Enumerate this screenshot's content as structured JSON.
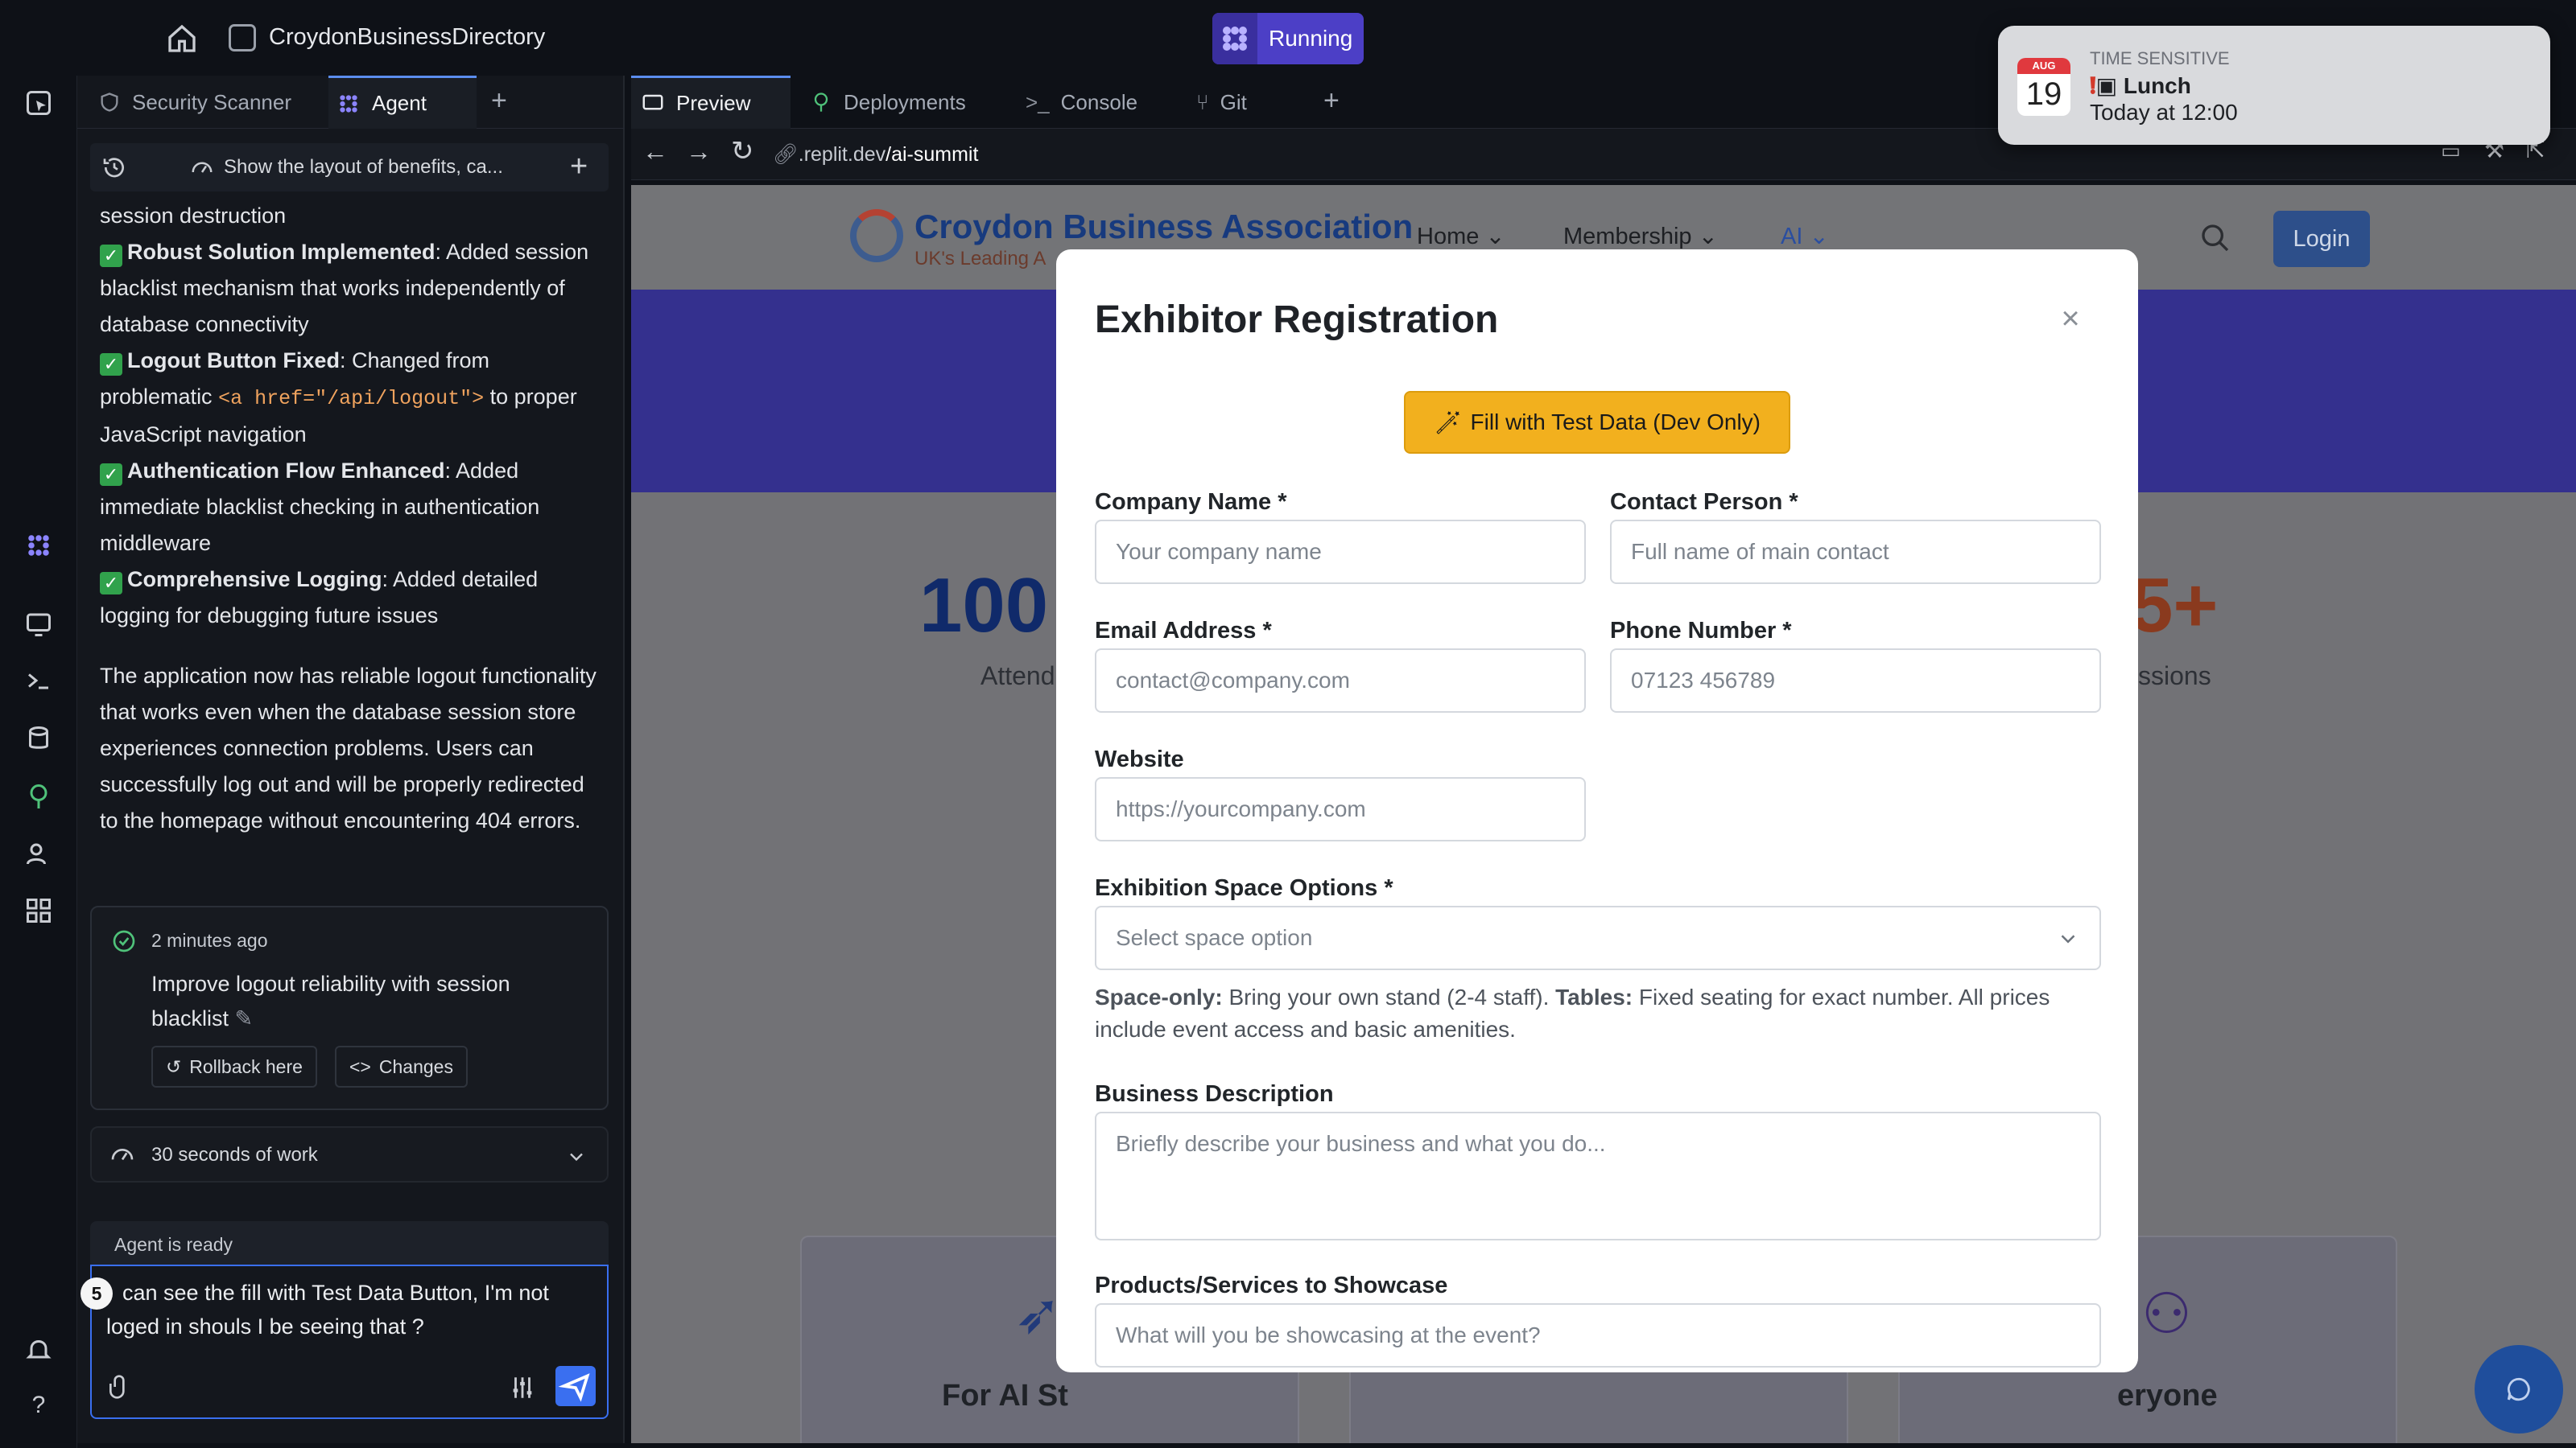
{
  "topbar": {
    "repl_name": "CroydonBusinessDirectory",
    "run_label": "Running"
  },
  "left_tabs": [
    {
      "label": "Security Scanner"
    },
    {
      "label": "Agent"
    }
  ],
  "history": {
    "title": "Show the layout of benefits, ca..."
  },
  "chat": {
    "line_top": "session destruction",
    "items": [
      {
        "bold": "Robust Solution Implemented",
        "text": ": Added session blacklist mechanism that works independently of database connectivity"
      },
      {
        "bold": "Logout Button Fixed",
        "text_a": ": Changed from problematic ",
        "code": "<a href=\"/api/logout\">",
        "text_b": " to proper JavaScript navigation"
      },
      {
        "bold": "Authentication Flow Enhanced",
        "text": ": Added immediate blacklist checking in authentication middleware"
      },
      {
        "bold": "Comprehensive Logging",
        "text": ": Added detailed logging for debugging future issues"
      }
    ],
    "summary": "The application now has reliable logout functionality that works even when the database session store experiences connection problems. Users can successfully log out and will be properly redirected to the homepage without encountering 404 errors."
  },
  "checkpoint": {
    "time": "2 minutes ago",
    "title": "Improve logout reliability with session blacklist",
    "rollback_label": "Rollback here",
    "changes_label": "Changes"
  },
  "work": {
    "label": "30 seconds of work"
  },
  "agent_status": "Agent is ready",
  "input": {
    "badge": "5",
    "text": "can see the fill with Test Data Button, I'm not loged in shouls I be seeing that ?"
  },
  "right_tabs": [
    {
      "label": "Preview"
    },
    {
      "label": "Deployments"
    },
    {
      "label": "Console"
    },
    {
      "label": "Git"
    }
  ],
  "url": {
    "host": ".replit.dev",
    "path": "/ai-summit"
  },
  "site": {
    "brand": "Croydon Business Association",
    "tagline": "UK's Leading A",
    "nav": [
      "Home",
      "Membership",
      "AI"
    ],
    "login": "Login",
    "stat_left_num": "100",
    "stat_left_label": "Attend",
    "stat_right_num": "5+",
    "stat_right_label": "ssions",
    "card_left": "For AI St",
    "card_right": "eryone"
  },
  "modal": {
    "title": "Exhibitor Registration",
    "fill_button": "Fill with Test Data (Dev Only)",
    "company_label": "Company Name *",
    "company_ph": "Your company name",
    "contact_label": "Contact Person *",
    "contact_ph": "Full name of main contact",
    "email_label": "Email Address *",
    "email_ph": "contact@company.com",
    "phone_label": "Phone Number *",
    "phone_ph": "07123 456789",
    "website_label": "Website",
    "website_ph": "https://yourcompany.com",
    "space_label": "Exhibition Space Options *",
    "space_ph": "Select space option",
    "help_b1": "Space-only:",
    "help_t1": " Bring your own stand (2-4 staff). ",
    "help_b2": "Tables:",
    "help_t2": " Fixed seating for exact number. All prices include event access and basic amenities.",
    "desc_label": "Business Description",
    "desc_ph": "Briefly describe your business and what you do...",
    "products_label": "Products/Services to Showcase",
    "products_ph": "What will you be showcasing at the event?"
  },
  "notification": {
    "cal_month": "AUG",
    "cal_day": "19",
    "category": "TIME SENSITIVE",
    "title": "Lunch",
    "time": "Today at 12:00"
  },
  "colors": {
    "accent": "#3a6ff0",
    "run": "#4c3fc6",
    "fill_button": "#f2b01e",
    "hero": "#34308e"
  }
}
